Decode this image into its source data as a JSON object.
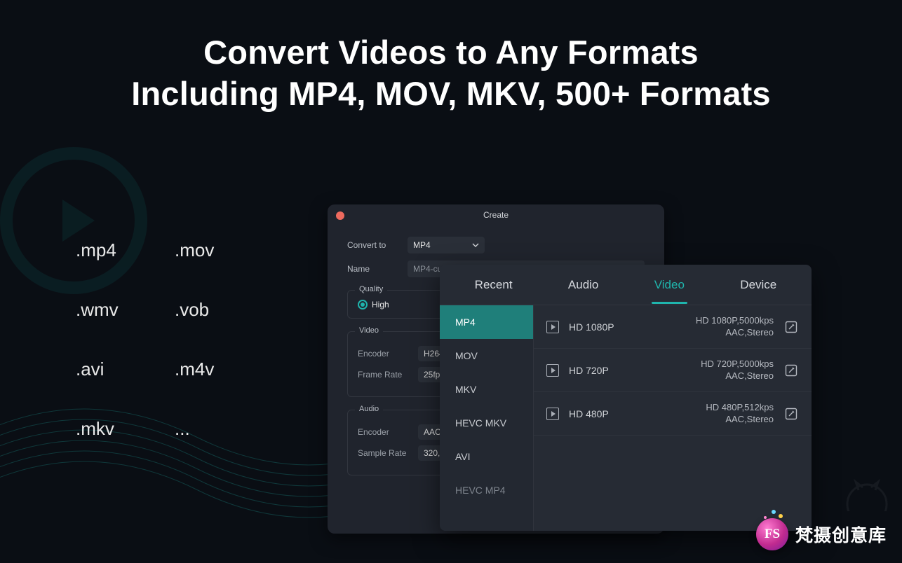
{
  "headline": {
    "line1": "Convert Videos to Any Formats",
    "line2": "Including MP4, MOV, MKV, 500+ Formats"
  },
  "format_grid": [
    ".mp4",
    ".mov",
    ".wmv",
    ".vob",
    ".avi",
    ".m4v",
    ".mkv",
    "..."
  ],
  "create_window": {
    "title": "Create",
    "convert_to_label": "Convert to",
    "convert_to_value": "MP4",
    "name_label": "Name",
    "name_value": "MP4-custom-1",
    "quality_section": "Quality",
    "quality_high": "High",
    "video_section": "Video",
    "video_encoder_label": "Encoder",
    "video_encoder_value": "H264",
    "video_framerate_label": "Frame Rate",
    "video_framerate_value": "25fps",
    "audio_section": "Audio",
    "audio_encoder_label": "Encoder",
    "audio_encoder_value": "AAC",
    "audio_samplerate_label": "Sample Rate",
    "audio_samplerate_value": "320,640"
  },
  "format_panel": {
    "tabs": {
      "recent": "Recent",
      "audio": "Audio",
      "video": "Video",
      "device": "Device"
    },
    "left_formats": [
      "MP4",
      "MOV",
      "MKV",
      "HEVC MKV",
      "AVI",
      "HEVC MP4"
    ],
    "presets": [
      {
        "res": "HD 1080P",
        "spec1": "HD 1080P,5000kps",
        "spec2": "AAC,Stereo"
      },
      {
        "res": "HD 720P",
        "spec1": "HD 720P,5000kps",
        "spec2": "AAC,Stereo"
      },
      {
        "res": "HD 480P",
        "spec1": "HD 480P,512kps",
        "spec2": "AAC,Stereo"
      }
    ]
  },
  "brand": {
    "initials": "FS",
    "text": "梵摄创意库"
  }
}
